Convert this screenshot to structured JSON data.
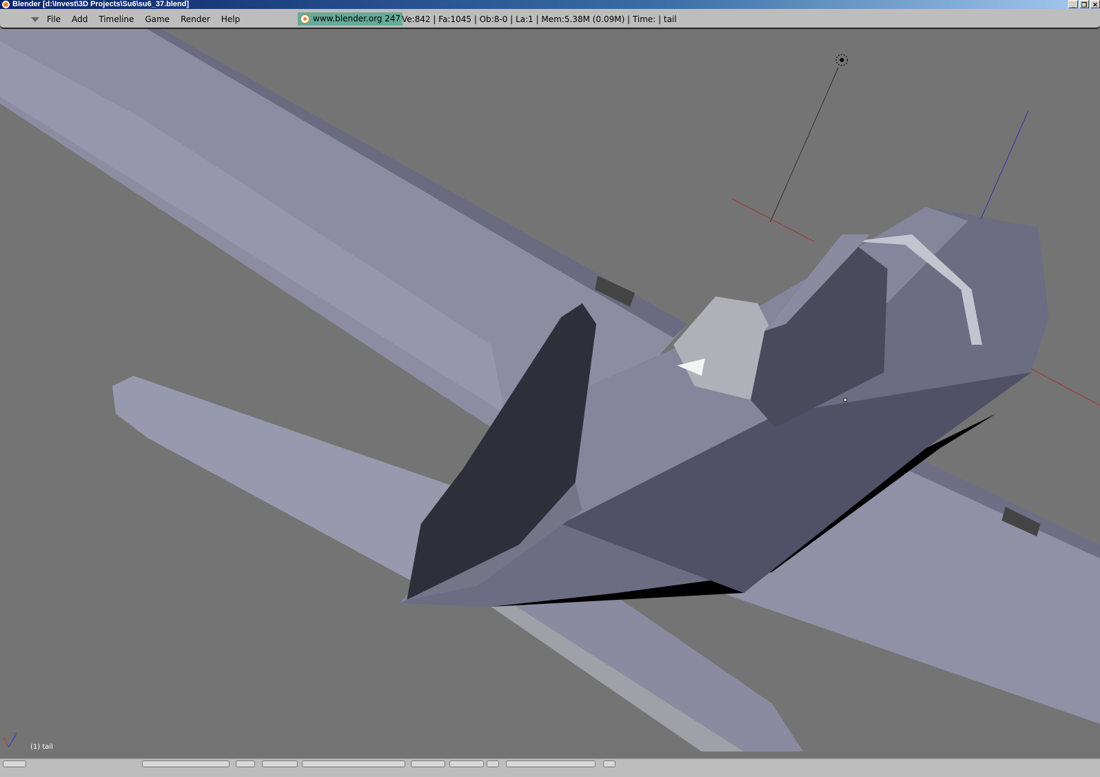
{
  "window": {
    "title": "Blender [d:\\Invest\\3D Projects\\Su6\\su6_37.blend]",
    "buttons": [
      "_",
      "❐",
      "✕"
    ]
  },
  "menu": {
    "items": [
      "File",
      "Add",
      "Timeline",
      "Game",
      "Render",
      "Help"
    ]
  },
  "header": {
    "site": "www.blender.org 247",
    "stats": "Ve:842 | Fa:1045 | Ob:8-0 | La:1  | Mem:5.38M (0.09M)  | Time: | tail"
  },
  "viewport": {
    "object_label": "(1) tail",
    "background": "#747474",
    "mesh_color": "#8e8ea6"
  },
  "axes": {
    "x": "X",
    "z": "Z"
  }
}
